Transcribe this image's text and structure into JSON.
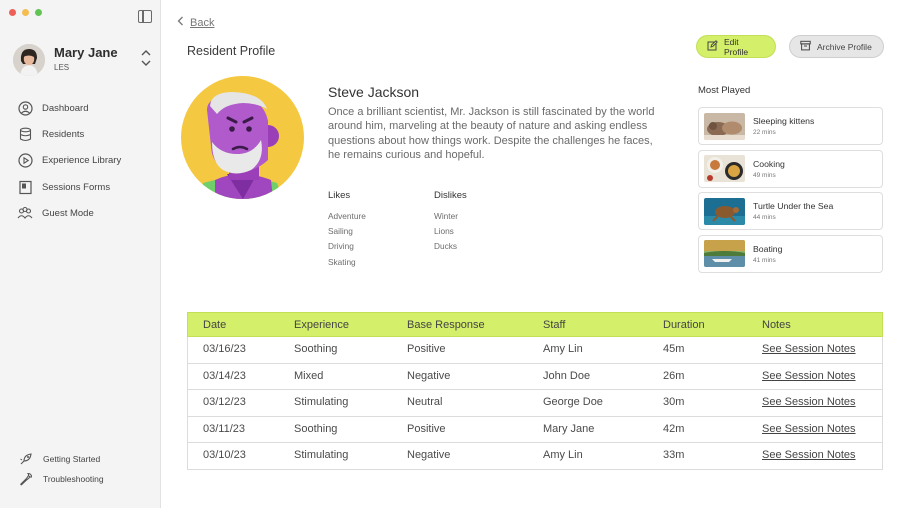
{
  "sidebar": {
    "user": {
      "name": "Mary Jane",
      "org": "LES"
    },
    "nav": [
      {
        "label": "Dashboard",
        "icon": "dashboard-icon"
      },
      {
        "label": "Residents",
        "icon": "database-icon"
      },
      {
        "label": "Experience Library",
        "icon": "play-circle-icon"
      },
      {
        "label": "Sessions Forms",
        "icon": "form-icon"
      },
      {
        "label": "Guest Mode",
        "icon": "guests-icon"
      }
    ],
    "bottom": [
      {
        "label": "Getting Started",
        "icon": "rocket-icon"
      },
      {
        "label": "Troubleshooting",
        "icon": "wrench-icon"
      }
    ]
  },
  "header": {
    "back": "Back",
    "title": "Resident Profile"
  },
  "actions": {
    "edit": "Edit Profile",
    "archive": "Archive Profile"
  },
  "resident": {
    "name": "Steve Jackson",
    "bio": "Once a brilliant scientist, Mr. Jackson is still fascinated by the world around him, marveling at the beauty of nature and asking endless questions about how things work. Despite the challenges he faces, he remains curious and hopeful.",
    "likes_label": "Likes",
    "likes": [
      "Adventure",
      "Sailing",
      "Driving",
      "Skating"
    ],
    "dislikes_label": "Dislikes",
    "dislikes": [
      "Winter",
      "Lions",
      "Ducks"
    ]
  },
  "most_played": {
    "title": "Most Played",
    "items": [
      {
        "name": "Sleeping kittens",
        "duration": "22 mins"
      },
      {
        "name": "Cooking",
        "duration": "49 mins"
      },
      {
        "name": "Turtle Under the Sea",
        "duration": "44 mins"
      },
      {
        "name": "Boating",
        "duration": "41 mins"
      }
    ]
  },
  "sessions": {
    "columns": [
      "Date",
      "Experience",
      "Base Response",
      "Staff",
      "Duration",
      "Notes"
    ],
    "rows": [
      {
        "date": "03/16/23",
        "experience": "Soothing",
        "response": "Positive",
        "staff": "Amy Lin",
        "duration": "45m",
        "notes": "See Session Notes"
      },
      {
        "date": "03/14/23",
        "experience": "Mixed",
        "response": "Negative",
        "staff": "John Doe",
        "duration": "26m",
        "notes": "See Session Notes"
      },
      {
        "date": "03/12/23",
        "experience": "Stimulating",
        "response": "Neutral",
        "staff": "George Doe",
        "duration": "30m",
        "notes": "See Session Notes"
      },
      {
        "date": "03/11/23",
        "experience": "Soothing",
        "response": "Positive",
        "staff": "Mary Jane",
        "duration": "42m",
        "notes": "See Session Notes"
      },
      {
        "date": "03/10/23",
        "experience": "Stimulating",
        "response": "Negative",
        "staff": "Amy Lin",
        "duration": "33m",
        "notes": "See Session Notes"
      }
    ]
  },
  "colors": {
    "accent": "#d4ef6a",
    "portrait_bg": "#f5c842",
    "avatar_face": "#9b3fb8"
  }
}
